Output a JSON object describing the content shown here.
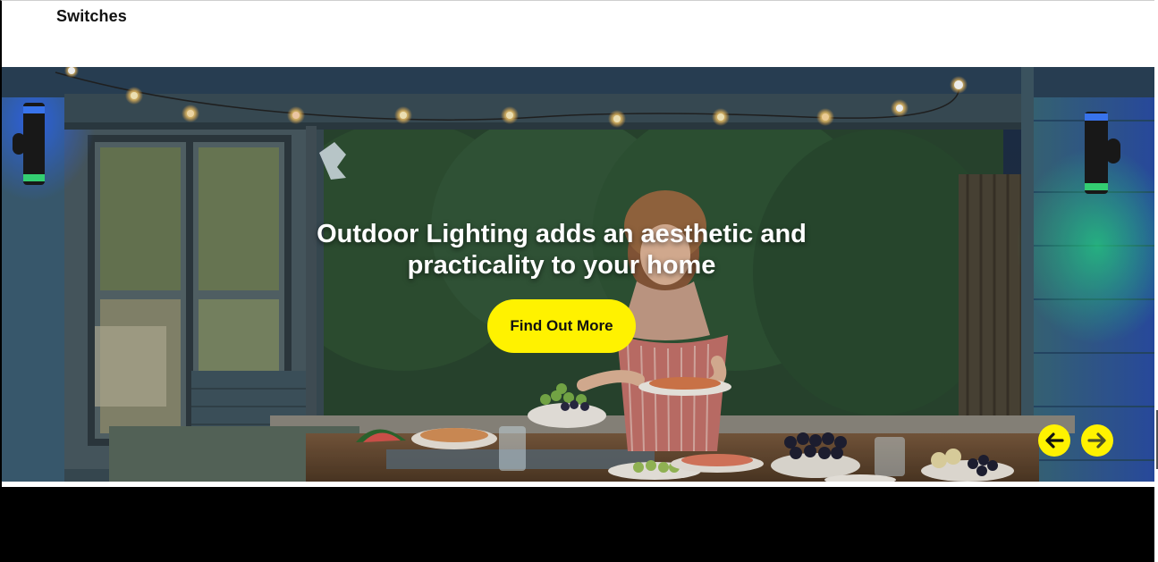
{
  "nav": {
    "item_label": "Switches"
  },
  "hero": {
    "headline": "Outdoor Lighting adds an aesthetic and practicality to your home",
    "cta_label": "Find Out More",
    "prev_icon": "arrow-left-icon",
    "next_icon": "arrow-right-icon"
  },
  "colors": {
    "accent": "#fff200",
    "footer": "#000000",
    "text_light": "#ffffff"
  }
}
